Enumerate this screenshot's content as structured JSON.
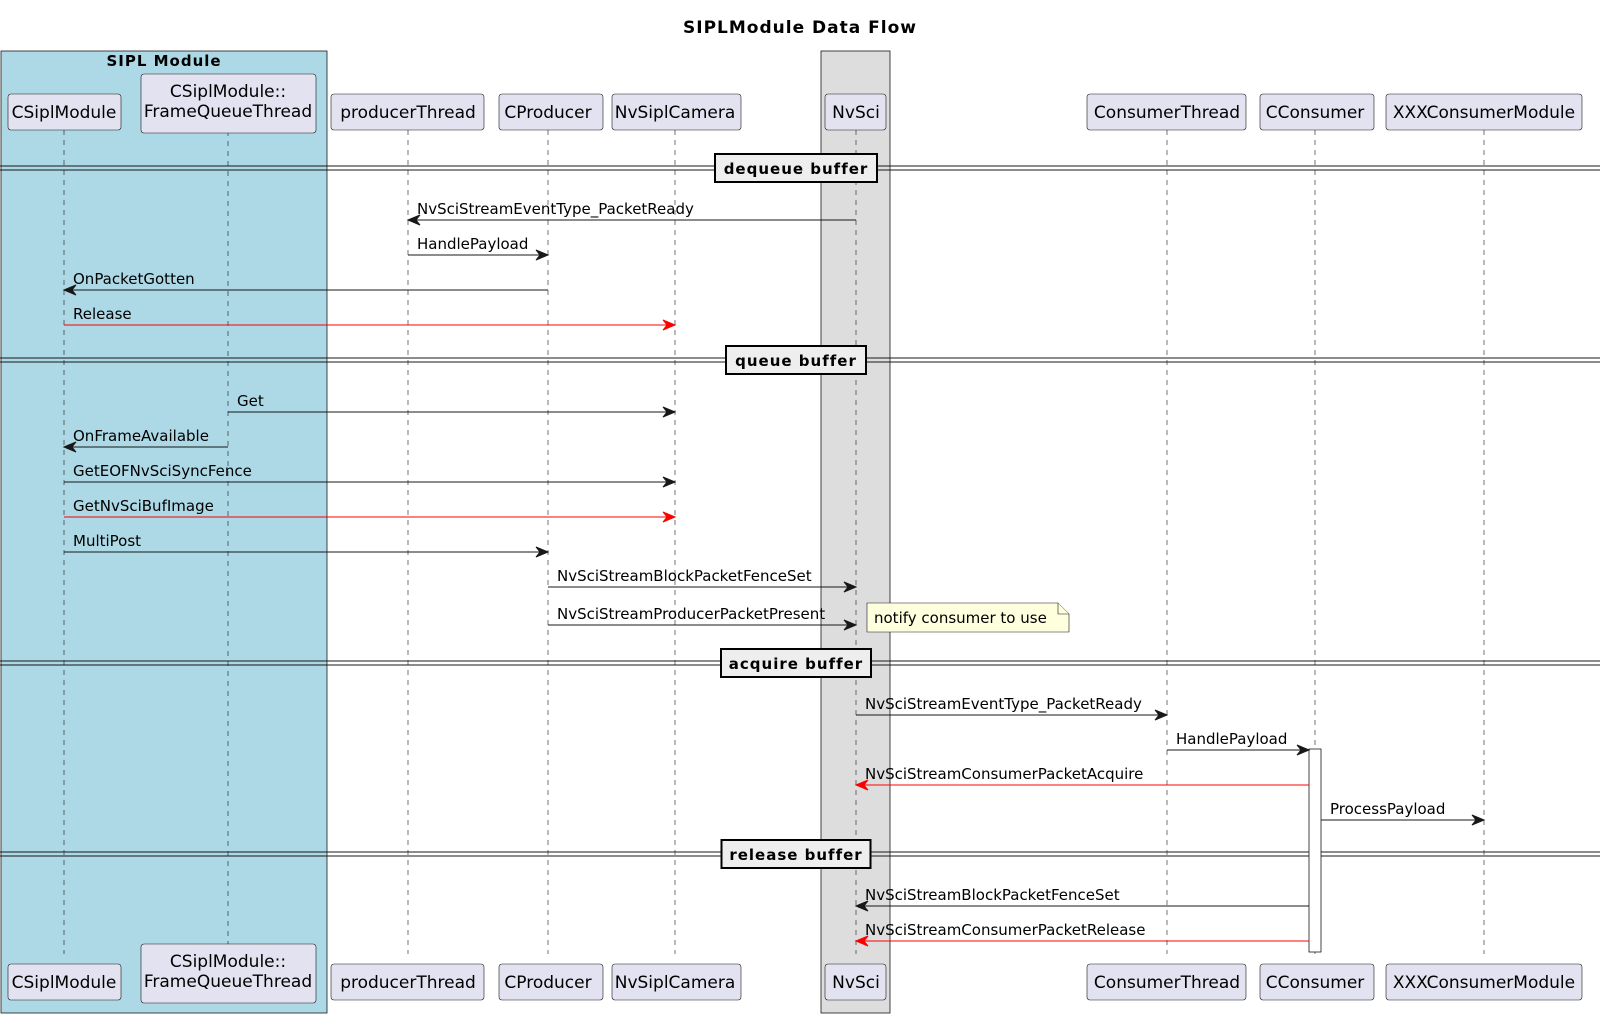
{
  "title": "SIPLModule Data Flow",
  "colors": {
    "participant_fill": "#E2E2F0",
    "participant_stroke": "#181818",
    "group_sipl": "#ADD8E6",
    "group_nvsci": "#DDDDDD",
    "arrow_default": "#181818",
    "arrow_highlight": "#FF0000",
    "note_fill": "#FEFFDD",
    "divider_fill": "#EEEEEE"
  },
  "groups": [
    {
      "id": "sipl",
      "label": "SIPL Module",
      "color": "#ADD8E6"
    },
    {
      "id": "nvsci",
      "label": "",
      "color": "#DDDDDD"
    }
  ],
  "participants": [
    {
      "id": "csiplmodule",
      "lines": [
        "CSiplModule"
      ]
    },
    {
      "id": "framequeuethread",
      "lines": [
        "CSiplModule::",
        "FrameQueueThread"
      ]
    },
    {
      "id": "producerthread",
      "lines": [
        "producerThread"
      ]
    },
    {
      "id": "cproducer",
      "lines": [
        "CProducer"
      ]
    },
    {
      "id": "nvsiplcamera",
      "lines": [
        "NvSiplCamera"
      ]
    },
    {
      "id": "nvsci",
      "lines": [
        "NvSci"
      ]
    },
    {
      "id": "consumerthread",
      "lines": [
        "ConsumerThread"
      ]
    },
    {
      "id": "cconsumer",
      "lines": [
        "CConsumer"
      ]
    },
    {
      "id": "xxxconsumermodule",
      "lines": [
        "XXXConsumerModule"
      ]
    }
  ],
  "dividers": [
    {
      "label": "dequeue buffer"
    },
    {
      "label": "queue buffer"
    },
    {
      "label": "acquire buffer"
    },
    {
      "label": "release buffer"
    }
  ],
  "messages": [
    {
      "from": "nvsci",
      "to": "producerthread",
      "label": "NvSciStreamEventType_PacketReady",
      "highlight": false
    },
    {
      "from": "producerthread",
      "to": "cproducer",
      "label": "HandlePayload",
      "highlight": false
    },
    {
      "from": "cproducer",
      "to": "csiplmodule",
      "label": "OnPacketGotten",
      "highlight": false
    },
    {
      "from": "csiplmodule",
      "to": "nvsiplcamera",
      "label": "Release",
      "highlight": true
    },
    {
      "from": "framequeuethread",
      "to": "nvsiplcamera",
      "label": "Get",
      "highlight": false
    },
    {
      "from": "framequeuethread",
      "to": "csiplmodule",
      "label": "OnFrameAvailable",
      "highlight": false
    },
    {
      "from": "csiplmodule",
      "to": "nvsiplcamera",
      "label": "GetEOFNvSciSyncFence",
      "highlight": false
    },
    {
      "from": "csiplmodule",
      "to": "nvsiplcamera",
      "label": "GetNvSciBufImage",
      "highlight": true
    },
    {
      "from": "csiplmodule",
      "to": "cproducer",
      "label": "MultiPost",
      "highlight": false
    },
    {
      "from": "cproducer",
      "to": "nvsci",
      "label": "NvSciStreamBlockPacketFenceSet",
      "highlight": false
    },
    {
      "from": "cproducer",
      "to": "nvsci",
      "label": "NvSciStreamProducerPacketPresent",
      "highlight": false
    },
    {
      "from": "nvsci",
      "to": "consumerthread",
      "label": "NvSciStreamEventType_PacketReady",
      "highlight": false
    },
    {
      "from": "consumerthread",
      "to": "cconsumer",
      "label": "HandlePayload",
      "highlight": false
    },
    {
      "from": "cconsumer",
      "to": "nvsci",
      "label": "NvSciStreamConsumerPacketAcquire",
      "highlight": true
    },
    {
      "from": "cconsumer",
      "to": "xxxconsumermodule",
      "label": "ProcessPayload",
      "highlight": false
    },
    {
      "from": "cconsumer",
      "to": "nvsci",
      "label": "NvSciStreamBlockPacketFenceSet",
      "highlight": false
    },
    {
      "from": "cconsumer",
      "to": "nvsci",
      "label": "NvSciStreamConsumerPacketRelease",
      "highlight": true
    }
  ],
  "notes": [
    {
      "attached_to": "nvsci",
      "text": "notify consumer to use"
    }
  ]
}
